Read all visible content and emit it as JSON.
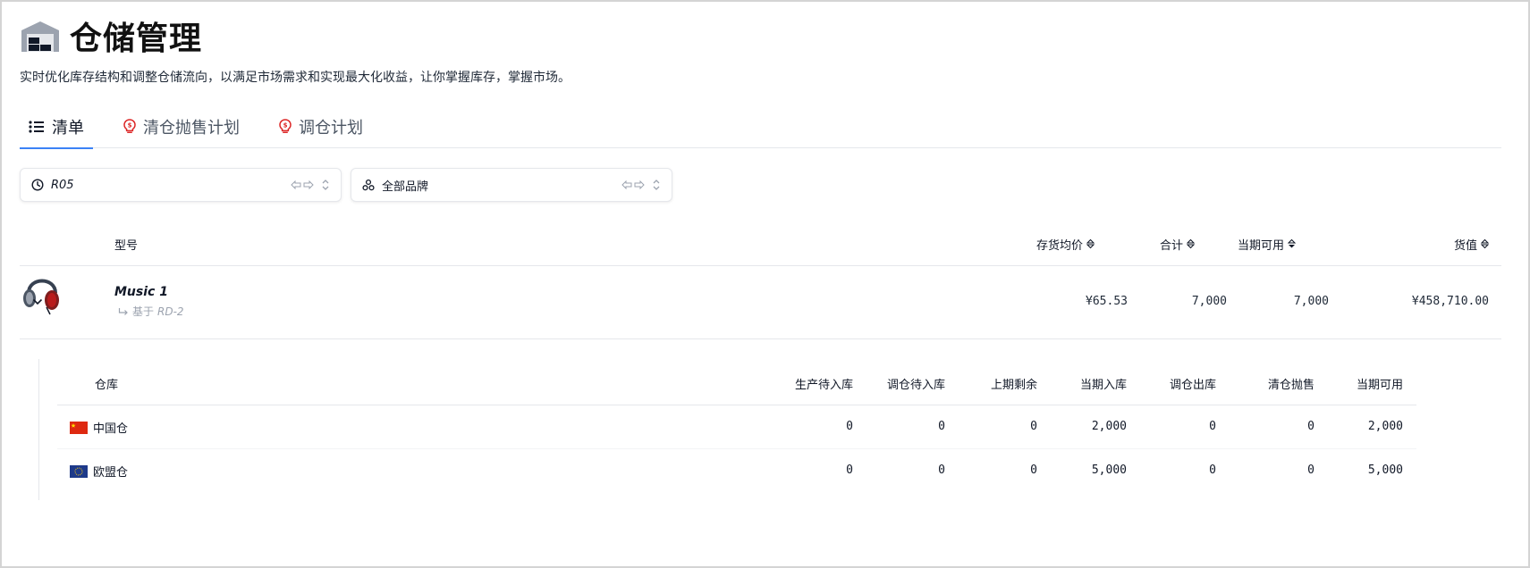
{
  "header": {
    "title": "仓储管理",
    "subtitle": "实时优化库存结构和调整仓储流向，以满足市场需求和实现最大化收益，让你掌握库存，掌握市场。",
    "icon": "warehouse-icon"
  },
  "tabs": [
    {
      "label": "清单",
      "icon": "list-icon",
      "active": true
    },
    {
      "label": "清仓抛售计划",
      "icon": "lightbulb-dollar-icon",
      "active": false
    },
    {
      "label": "调仓计划",
      "icon": "lightbulb-dollar-icon",
      "active": false
    }
  ],
  "filters": {
    "period": {
      "value": "R05",
      "icon": "clock-icon"
    },
    "brand": {
      "value": "全部品牌",
      "icon": "shapes-icon"
    }
  },
  "main_table": {
    "columns": {
      "model": "型号",
      "avg_price": "存货均价",
      "total": "合计",
      "available": "当期可用",
      "value": "货值"
    },
    "rows": [
      {
        "name": "Music 1",
        "based_on_label": "基于",
        "based_on_ref": "RD-2",
        "avg_price": "¥65.53",
        "total": "7,000",
        "available": "7,000",
        "value": "¥458,710.00"
      }
    ]
  },
  "sub_table": {
    "columns": {
      "warehouse": "仓库",
      "pending_production": "生产待入库",
      "pending_transfer": "调仓待入库",
      "last_remaining": "上期剩余",
      "current_in": "当期入库",
      "transfer_out": "调仓出库",
      "clearance": "清仓抛售",
      "available": "当期可用"
    },
    "rows": [
      {
        "warehouse": "中国仓",
        "flag": "cn-flag",
        "pending_production": "0",
        "pending_transfer": "0",
        "last_remaining": "0",
        "current_in": "2,000",
        "transfer_out": "0",
        "clearance": "0",
        "available": "2,000"
      },
      {
        "warehouse": "欧盟仓",
        "flag": "eu-flag",
        "pending_production": "0",
        "pending_transfer": "0",
        "last_remaining": "0",
        "current_in": "5,000",
        "transfer_out": "0",
        "clearance": "0",
        "available": "5,000"
      }
    ]
  },
  "colors": {
    "accent": "#3b82f6",
    "tab_icon": "#dc2626",
    "muted": "#9ca3af"
  }
}
